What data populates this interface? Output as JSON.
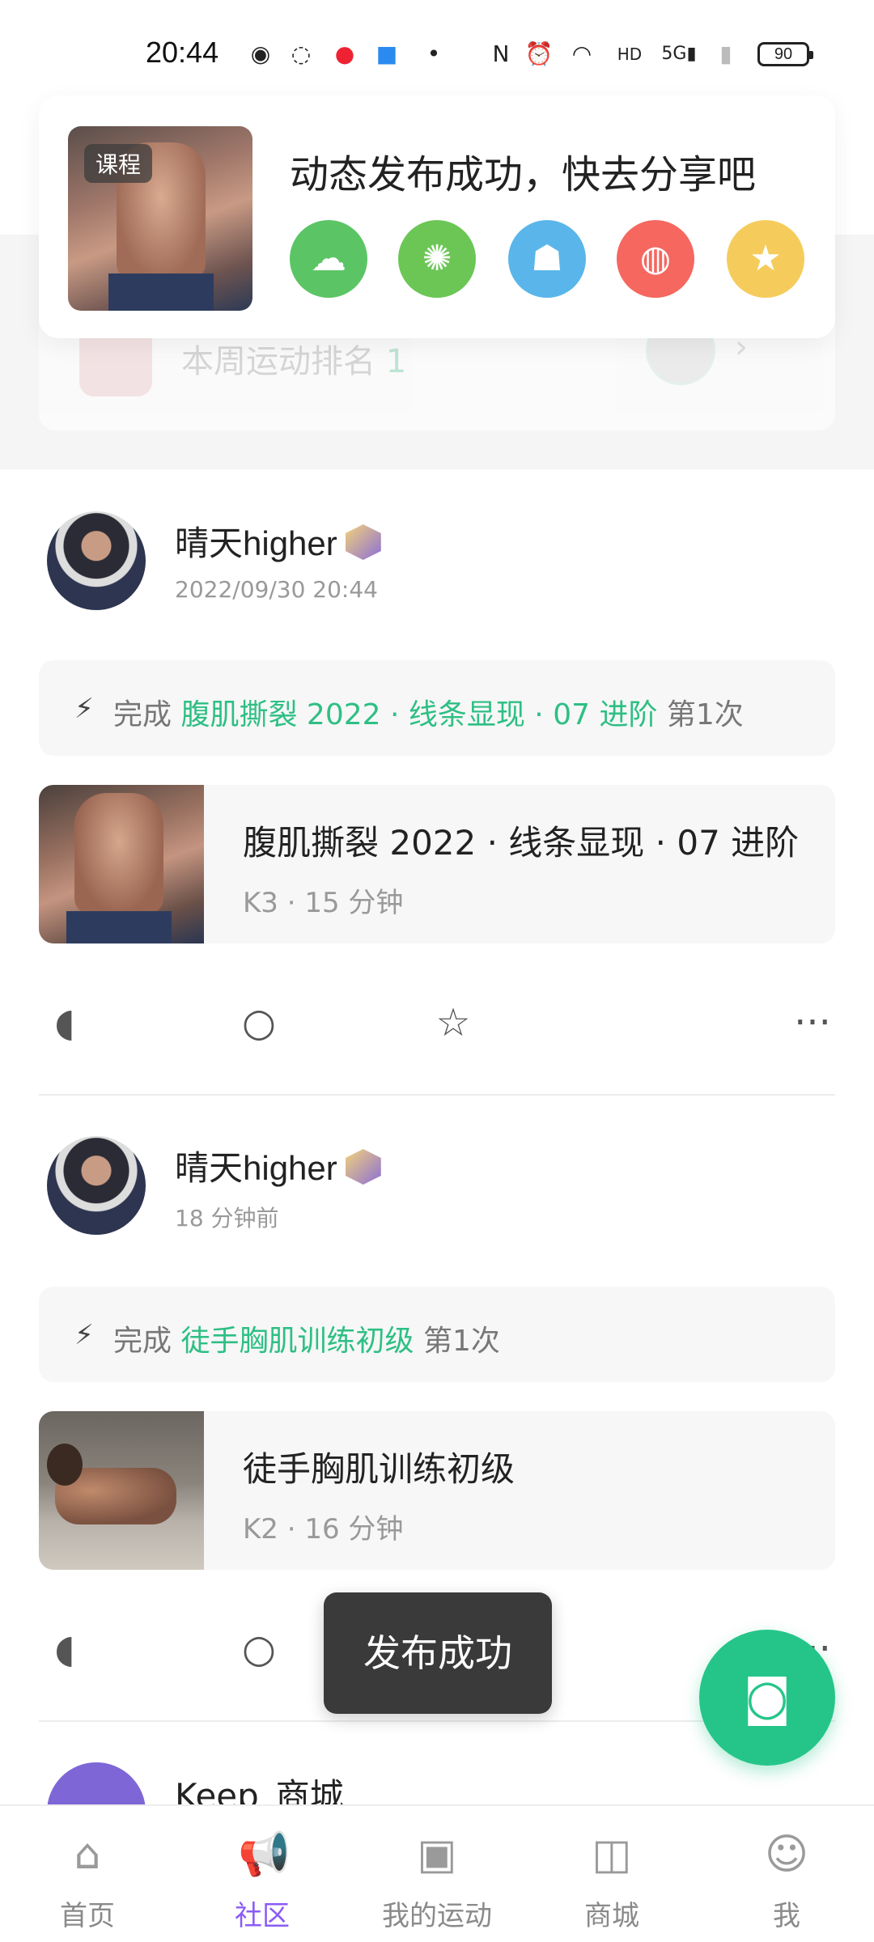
{
  "status_bar": {
    "time": "20:44",
    "battery": "90",
    "icons": [
      "wechat-icon",
      "chat-bubble-icon",
      "red-app-icon",
      "blue-app-icon",
      "dot-icon",
      "nfc-icon",
      "alarm-icon",
      "wifi-icon",
      "hd-icon",
      "signal-5g-icon",
      "signal-icon"
    ]
  },
  "share_popup": {
    "thumb_tag": "课程",
    "title": "动态发布成功，快去分享吧",
    "buttons": [
      {
        "name": "wechat",
        "icon": "wechat-icon",
        "color": "#5bc565"
      },
      {
        "name": "moments",
        "icon": "moments-icon",
        "color": "#6cc656"
      },
      {
        "name": "qq",
        "icon": "qq-icon",
        "color": "#5ab6ea"
      },
      {
        "name": "weibo",
        "icon": "weibo-icon",
        "color": "#f5675f"
      },
      {
        "name": "qzone",
        "icon": "qzone-icon",
        "color": "#f5cc5c"
      }
    ]
  },
  "rank_card": {
    "text": "本周运动排名",
    "rank": "1"
  },
  "posts": [
    {
      "username": "晴天higher",
      "time": "2022/09/30 20:44",
      "complete_prefix": "完成",
      "complete_course": "腹肌撕裂 2022 · 线条显现 · 07 进阶",
      "complete_suffix": "第1次",
      "course_title": "腹肌撕裂 2022 · 线条显现 · 07 进阶",
      "course_meta": "K3 · 15 分钟"
    },
    {
      "username": "晴天higher",
      "time": "18 分钟前",
      "complete_prefix": "完成",
      "complete_course": "徒手胸肌训练初级",
      "complete_suffix": "第1次",
      "course_title": "徒手胸肌训练初级",
      "course_meta": "K2 · 16 分钟"
    },
    {
      "username": "Keep_商城"
    }
  ],
  "toast": "发布成功",
  "bottom_nav": [
    {
      "label": "首页",
      "icon": "home-icon",
      "active": false
    },
    {
      "label": "社区",
      "icon": "megaphone-icon",
      "active": true
    },
    {
      "label": "我的运动",
      "icon": "calendar-bolt-icon",
      "active": false
    },
    {
      "label": "商城",
      "icon": "shopping-bag-icon",
      "active": false
    },
    {
      "label": "我",
      "icon": "face-icon",
      "active": false
    }
  ],
  "colors": {
    "accent_green": "#25c589",
    "course_green": "#2ebf84",
    "nav_active": "#8a5cf6"
  }
}
